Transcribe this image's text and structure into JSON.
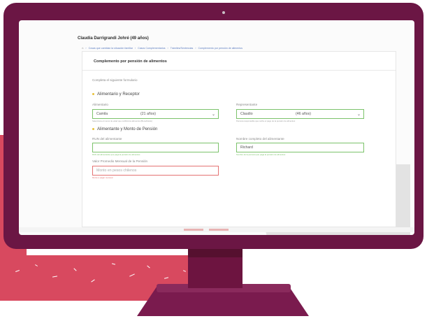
{
  "patient": {
    "name": "Claudia Darrigrandi Johré (49 años)"
  },
  "breadcrumb": [
    "Cosas que cambian la situación familiar",
    "Casos Complementarios",
    "Trámites/Sentencias",
    "Complemento por pensión de alimentos"
  ],
  "form": {
    "title": "Complemento por pensión de alimentos",
    "instructions": "Completa el siguiente formulario",
    "section1": {
      "title": "Alimentario y Receptor",
      "alimentario": {
        "label": "Alimentario",
        "value": "Camila",
        "age": "(21 años)",
        "help": "Selecciona el menor de edad que recibirá los alimentos (Beneficiario)"
      },
      "representante": {
        "label": "Representante",
        "value": "Claudio",
        "age": "(46 años)",
        "help": "Persona responsable que recibe el pago de la pensión de alimentos"
      }
    },
    "section2": {
      "title": "Alimentante y Monto de Pensión",
      "rut": {
        "label": "RUN del alimentante",
        "value": "",
        "help": "RUN del alimentante que paga la pensión de alimentos"
      },
      "nombre": {
        "label": "Nombre completo del alimentante",
        "value": "Richard",
        "help": "Nombre de la persona que paga la pensión de alimentos"
      },
      "monto": {
        "label": "Valor Promedio Mensual de la Pensión",
        "placeholder": "Monto en pesos chilenos",
        "help": "Monto a pagar mensual"
      }
    }
  },
  "colors": {
    "monitor": "#6b1644",
    "accent_red": "#d8495f",
    "valid_green": "#7cc36b",
    "error_red": "#e57373",
    "section_dot": "#e8c23b"
  }
}
